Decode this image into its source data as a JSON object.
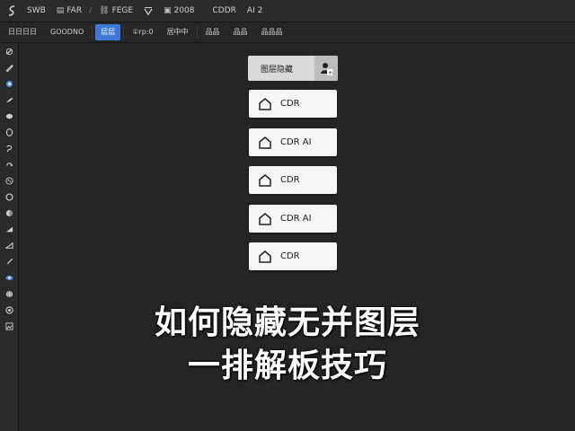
{
  "menubar": {
    "logo_icon": "app-logo-icon",
    "items": [
      {
        "label": "SWB",
        "icon": ""
      },
      {
        "label": "FAR",
        "icon": "doc-icon"
      },
      {
        "label": "/",
        "icon": ""
      },
      {
        "label": "FEGE",
        "icon": "link-icon"
      },
      {
        "label": "",
        "icon": "v-icon"
      },
      {
        "label": "2008",
        "icon": "frame-icon"
      },
      {
        "label": "CDDR",
        "icon": ""
      },
      {
        "label": "AI 2",
        "icon": ""
      }
    ]
  },
  "toolbar": {
    "buttons": [
      {
        "label": "日日日日",
        "active": false
      },
      {
        "label": "GOODNO",
        "active": false
      },
      {
        "label": "层层",
        "active": true
      },
      {
        "label": "①rp:0",
        "active": false
      },
      {
        "label": "居中中",
        "active": false
      },
      {
        "label": "品品",
        "active": false
      },
      {
        "label": "品品",
        "active": false
      },
      {
        "label": "品品品",
        "active": false
      }
    ]
  },
  "tools": [
    "pen-icon",
    "knife-icon",
    "color-dot-icon",
    "brush-icon",
    "eraser-icon",
    "ellipse-icon",
    "lasso-icon",
    "rotate-icon",
    "pattern-icon",
    "circle-icon",
    "fill-icon",
    "gradient-icon",
    "triangle-icon",
    "pencil-icon",
    "eye-icon",
    "globe-icon",
    "target-icon",
    "image-icon"
  ],
  "layers_panel": {
    "header_label": "图层隐藏",
    "header_icon": "user-add-icon",
    "rows": [
      {
        "label": "CDR",
        "icon": "house-icon"
      },
      {
        "label": "CDR AI",
        "icon": "house-icon"
      },
      {
        "label": "CDR",
        "icon": "house-icon"
      },
      {
        "label": "CDR AI",
        "icon": "house-icon"
      },
      {
        "label": "CDR",
        "icon": "house-icon"
      }
    ]
  },
  "caption": {
    "line1": "如何隐藏无并图层",
    "line2": "一排解板技巧"
  },
  "colors": {
    "background": "#1e1e1e",
    "accent": "#3f7ad6",
    "panel_row": "#f6f6f6",
    "caption_text": "#ffffff"
  }
}
